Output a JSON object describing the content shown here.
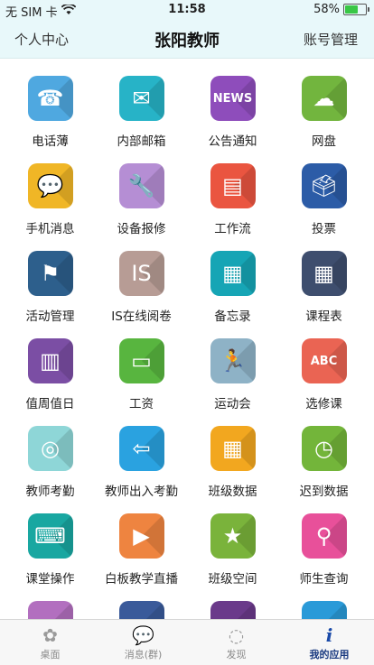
{
  "status_bar": {
    "carrier": "无 SIM 卡",
    "time": "11:58",
    "battery": "58%",
    "battery_level": 0.58
  },
  "nav": {
    "left": "个人中心",
    "title": "张阳教师",
    "right": "账号管理"
  },
  "apps": [
    {
      "label": "电话薄",
      "icon": "phone-book-icon",
      "glyph": "☎",
      "color": "#4fa8e0"
    },
    {
      "label": "内部邮箱",
      "icon": "mailbox-icon",
      "glyph": "✉",
      "color": "#27b3c7"
    },
    {
      "label": "公告通知",
      "icon": "newspaper-icon",
      "glyph": "NEWS",
      "color": "#8e4dbb"
    },
    {
      "label": "网盘",
      "icon": "hard-drive-icon",
      "glyph": "☁",
      "color": "#72b53e"
    },
    {
      "label": "手机消息",
      "icon": "mobile-message-icon",
      "glyph": "💬",
      "color": "#f0b626"
    },
    {
      "label": "设备报修",
      "icon": "repair-tools-icon",
      "glyph": "🔧",
      "color": "#b58ed4"
    },
    {
      "label": "工作流",
      "icon": "workflow-icon",
      "glyph": "▤",
      "color": "#ea5540"
    },
    {
      "label": "投票",
      "icon": "vote-box-icon",
      "glyph": "🗳",
      "color": "#2c5ca7"
    },
    {
      "label": "活动管理",
      "icon": "activity-flag-icon",
      "glyph": "⚑",
      "color": "#2d5f8c"
    },
    {
      "label": "IS在线阅卷",
      "icon": "online-exam-icon",
      "glyph": "IS",
      "color": "#b79c95"
    },
    {
      "label": "备忘录",
      "icon": "memo-notebook-icon",
      "glyph": "▦",
      "color": "#16a5b5"
    },
    {
      "label": "课程表",
      "icon": "calendar-icon",
      "glyph": "▦",
      "color": "#3e4e6e"
    },
    {
      "label": "值周值日",
      "icon": "duty-roster-icon",
      "glyph": "▥",
      "color": "#7b4ea4"
    },
    {
      "label": "工资",
      "icon": "wallet-icon",
      "glyph": "▭",
      "color": "#58b53f"
    },
    {
      "label": "运动会",
      "icon": "sports-meet-icon",
      "glyph": "🏃",
      "color": "#8eb2c6"
    },
    {
      "label": "选修课",
      "icon": "blackboard-abc-icon",
      "glyph": "ABC",
      "color": "#ea6453"
    },
    {
      "label": "教师考勤",
      "icon": "fingerprint-icon",
      "glyph": "◎",
      "color": "#8ed6d7"
    },
    {
      "label": "教师出入考勤",
      "icon": "door-exit-icon",
      "glyph": "⇦",
      "color": "#2aa2e0"
    },
    {
      "label": "班级数据",
      "icon": "chart-grid-icon",
      "glyph": "▦",
      "color": "#f2a71f"
    },
    {
      "label": "迟到数据",
      "icon": "clock-icon",
      "glyph": "◷",
      "color": "#73b53a"
    },
    {
      "label": "课堂操作",
      "icon": "classroom-desk-icon",
      "glyph": "⌨",
      "color": "#19a7a1"
    },
    {
      "label": "白板教学直播",
      "icon": "whiteboard-live-icon",
      "glyph": "▶",
      "color": "#ee8440"
    },
    {
      "label": "班级空间",
      "icon": "star-icon",
      "glyph": "★",
      "color": "#7ab33b"
    },
    {
      "label": "师生查询",
      "icon": "magnifier-icon",
      "glyph": "⚲",
      "color": "#e8509a"
    },
    {
      "label": "",
      "icon": "partial-app-icon-1",
      "glyph": "",
      "color": "#b26fbf"
    },
    {
      "label": "",
      "icon": "partial-app-icon-2",
      "glyph": "",
      "color": "#3a5a9a"
    },
    {
      "label": "",
      "icon": "partial-app-icon-3",
      "glyph": "",
      "color": "#6a3a8a"
    },
    {
      "label": "",
      "icon": "partial-app-icon-4",
      "glyph": "",
      "color": "#2a9ad8"
    }
  ],
  "tabs": [
    {
      "label": "桌面",
      "icon": "desktop-grid-icon",
      "glyph": "✿",
      "active": false
    },
    {
      "label": "消息(群)",
      "icon": "message-bubble-icon",
      "glyph": "💬",
      "active": false
    },
    {
      "label": "发现",
      "icon": "discover-icon",
      "glyph": "◌",
      "active": false
    },
    {
      "label": "我的应用",
      "icon": "my-apps-icon",
      "glyph": "i",
      "active": true
    }
  ]
}
